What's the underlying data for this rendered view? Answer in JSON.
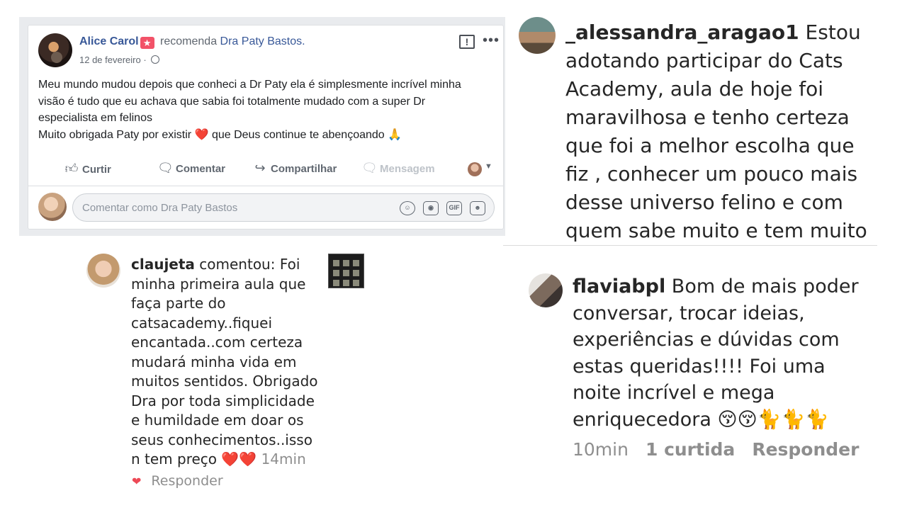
{
  "fb_post": {
    "author": "Alice Carol",
    "recommends": "recomenda",
    "page": "Dra Paty Bastos.",
    "date": "12 de fevereiro",
    "date_separator": "·",
    "report_icon": "!",
    "more_icon": "•••",
    "text_lines": [
      "Meu mundo mudou depois que conheci a Dr Paty ela é simplesmente incrível minha",
      "visão é tudo que eu achava que sabia foi totalmente mudado com a super Dr",
      "especialista em felinos",
      "Muito obrigada Paty por existir"
    ],
    "text_line4_heart": "❤️",
    "text_line4_tail": "que Deus continue te abençoando",
    "text_line4_emoji": "🙏",
    "actions": {
      "like": "Curtir",
      "comment": "Comentar",
      "share": "Compartilhar",
      "message": "Mensagem"
    },
    "comment_placeholder": "Comentar como Dra Paty Bastos",
    "gif_label": "GIF"
  },
  "comments": {
    "alessandra": {
      "username": "_alessandra_aragao1",
      "lines": [
        " Estou",
        "adotando participar do Cats",
        "Academy, aula de hoje foi",
        "maravilhosa e tenho certeza",
        "que foi a melhor escolha que",
        "fiz , conhecer um pouco mais",
        "desse universo felino e com",
        "quem sabe muito e tem muito"
      ]
    },
    "flavia": {
      "username": "flaviabpl",
      "lines": [
        " Bom de mais poder",
        "conversar, trocar ideias,",
        "experiências e dúvidas com",
        "estas queridas!!!! Foi uma",
        "noite incrível e mega",
        "enriquecedora 😚😚🐈🐈🐈"
      ],
      "time": "10min",
      "likes": "1 curtida",
      "reply": "Responder"
    },
    "claujeta": {
      "username": "claujeta",
      "lines": [
        " comentou: Foi",
        "minha primeira aula que",
        "faça parte do",
        "catsacademy..fiquei",
        "encantada..com certeza",
        "mudará minha vida em",
        "muitos sentidos. Obrigado",
        "Dra por toda simplicidade",
        "e humildade em doar os",
        "seus conhecimentos..isso",
        "n tem preço"
      ],
      "hearts": "❤️❤️",
      "time": "14min",
      "reply": "Responder"
    }
  }
}
